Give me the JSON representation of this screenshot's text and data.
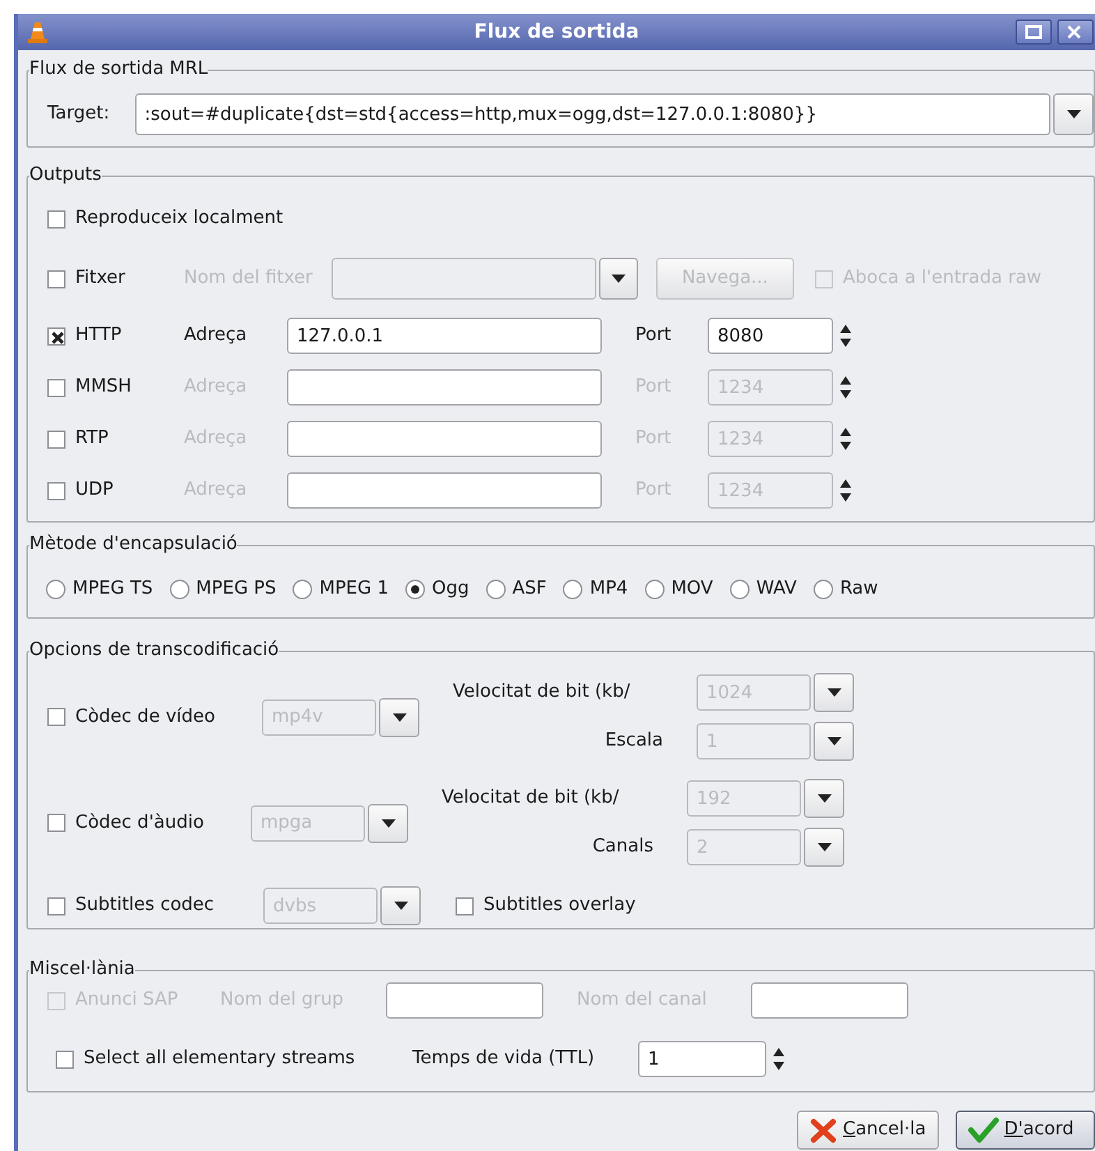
{
  "window": {
    "title": "Flux de sortida"
  },
  "mrl": {
    "legend": "Flux de sortida MRL",
    "target_label": "Target:",
    "target_value": ":sout=#duplicate{dst=std{access=http,mux=ogg,dst=127.0.0.1:8080}}"
  },
  "outputs": {
    "legend": "Outputs",
    "play_locally": {
      "label": "Reproduceix localment",
      "checked": false
    },
    "file": {
      "label": "Fitxer",
      "checked": false,
      "name_label": "Nom del fitxer",
      "browse": "Navega...",
      "dump_raw": {
        "label": "Aboca a l'entrada raw",
        "checked": false,
        "disabled": true
      }
    },
    "streams": [
      {
        "label": "HTTP",
        "checked": true,
        "address_label": "Adreça",
        "address": "127.0.0.1",
        "port_label": "Port",
        "port": "8080"
      },
      {
        "label": "MMSH",
        "checked": false,
        "address_label": "Adreça",
        "port_label": "Port",
        "port": "1234"
      },
      {
        "label": "RTP",
        "checked": false,
        "address_label": "Adreça",
        "port_label": "Port",
        "port": "1234"
      },
      {
        "label": "UDP",
        "checked": false,
        "address_label": "Adreça",
        "port_label": "Port",
        "port": "1234"
      }
    ]
  },
  "encapsulation": {
    "legend": "Mètode d'encapsulació",
    "options": [
      {
        "label": "MPEG TS",
        "selected": false
      },
      {
        "label": "MPEG PS",
        "selected": false
      },
      {
        "label": "MPEG 1",
        "selected": false
      },
      {
        "label": "Ogg",
        "selected": true
      },
      {
        "label": "ASF",
        "selected": false
      },
      {
        "label": "MP4",
        "selected": false
      },
      {
        "label": "MOV",
        "selected": false
      },
      {
        "label": "WAV",
        "selected": false
      },
      {
        "label": "Raw",
        "selected": false
      }
    ]
  },
  "transcoding": {
    "legend": "Opcions de transcodificació",
    "video": {
      "label": "Còdec de vídeo",
      "checked": false,
      "codec": "mp4v",
      "bitrate_label": "Velocitat de bit (kb/",
      "bitrate": "1024",
      "second_label": "Escala",
      "second": "1"
    },
    "audio": {
      "label": "Còdec d'àudio",
      "checked": false,
      "codec": "mpga",
      "bitrate_label": "Velocitat de bit (kb/",
      "bitrate": "192",
      "second_label": "Canals",
      "second": "2"
    },
    "subtitles": {
      "label": "Subtitles codec",
      "checked": false,
      "codec": "dvbs",
      "overlay": {
        "label": "Subtitles overlay",
        "checked": false
      }
    }
  },
  "misc": {
    "legend": "Miscel·lània",
    "sap": {
      "label": "Anunci SAP",
      "checked": false,
      "disabled": true
    },
    "group_label": "Nom del grup",
    "channel_label": "Nom del canal",
    "all_streams": {
      "label": "Select all elementary streams",
      "checked": false
    },
    "ttl_label": "Temps de vida (TTL)",
    "ttl": "1"
  },
  "buttons": [
    {
      "label": "Cancel·la",
      "kind": "cancel"
    },
    {
      "label": "D'acord",
      "kind": "ok"
    }
  ]
}
